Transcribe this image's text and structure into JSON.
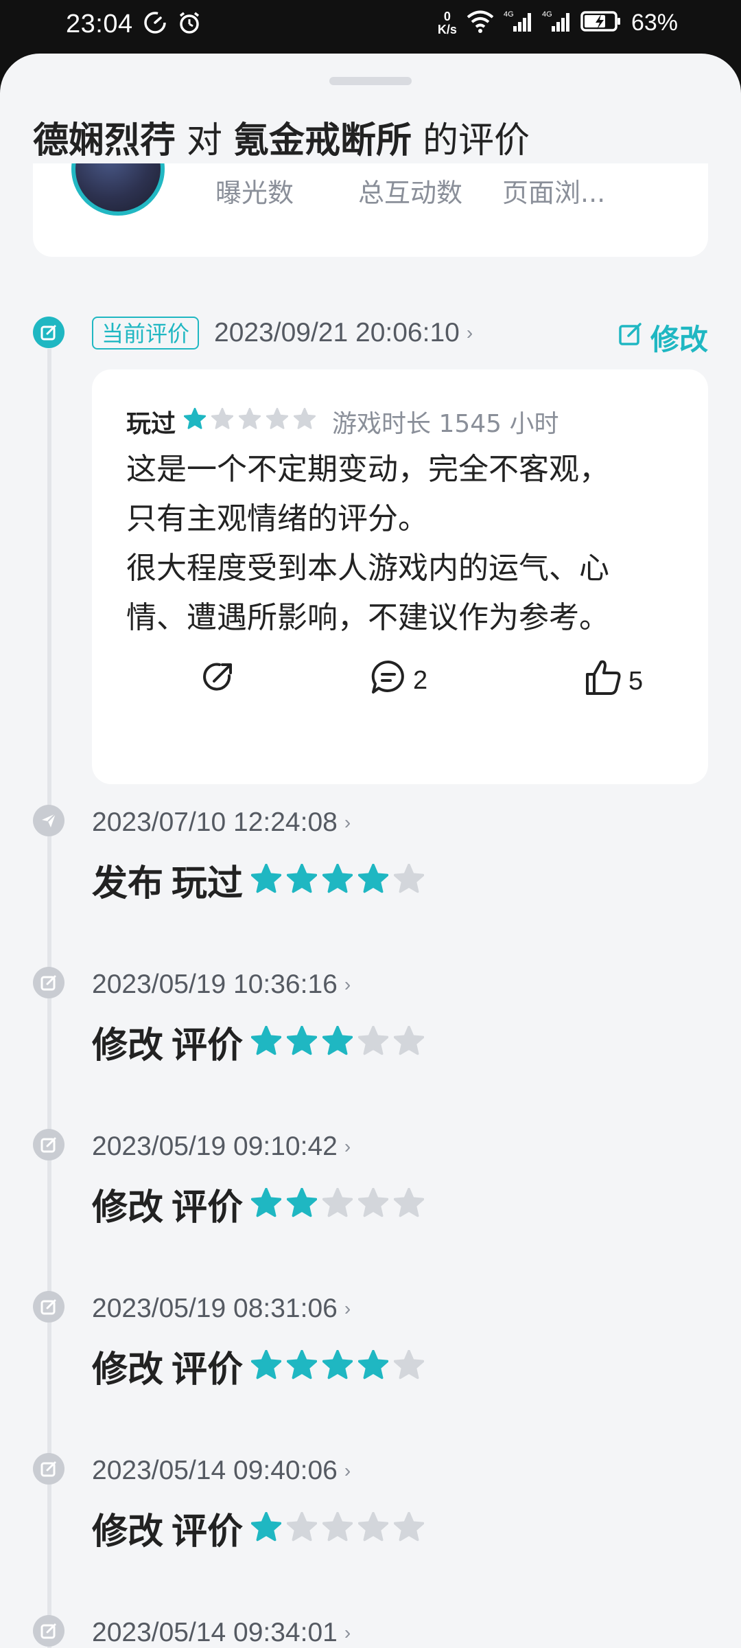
{
  "status_bar": {
    "time": "23:04",
    "net_speed_top": "0",
    "net_speed_bottom": "K/s",
    "battery_text": "63%"
  },
  "header": {
    "user": "德娴烈荇",
    "joiner": "对",
    "game": "氪金戒断所",
    "suffix": "的评价"
  },
  "stats": {
    "labels": [
      "曝光数",
      "总互动数",
      "页面浏..."
    ]
  },
  "current_review": {
    "tag": "当前评价",
    "datetime": "2023/09/21 20:06:10",
    "edit_label": "修改",
    "played_label": "玩过",
    "rating": 1,
    "playtime": "游戏时长 1545 小时",
    "body_lines": [
      "这是一个不定期变动，完全不客观，",
      "只有主观情绪的评分。",
      "很大程度受到本人游戏内的运气、心",
      "情、遭遇所影响，不建议作为参考。"
    ],
    "comment_count": "2",
    "like_count": "5"
  },
  "history": [
    {
      "datetime": "2023/07/10 12:24:08",
      "action": "发布",
      "type": "玩过",
      "rating": 4,
      "icon": "send-icon"
    },
    {
      "datetime": "2023/05/19 10:36:16",
      "action": "修改",
      "type": "评价",
      "rating": 3,
      "icon": "edit-icon"
    },
    {
      "datetime": "2023/05/19 09:10:42",
      "action": "修改",
      "type": "评价",
      "rating": 2,
      "icon": "edit-icon"
    },
    {
      "datetime": "2023/05/19 08:31:06",
      "action": "修改",
      "type": "评价",
      "rating": 4,
      "icon": "edit-icon"
    },
    {
      "datetime": "2023/05/14 09:40:06",
      "action": "修改",
      "type": "评价",
      "rating": 1,
      "icon": "edit-icon"
    },
    {
      "datetime": "2023/05/14 09:34:01",
      "action": "",
      "type": "",
      "rating": 0,
      "icon": "edit-icon"
    }
  ],
  "colors": {
    "accent": "#1fb7c2",
    "star_off": "#d3d6db",
    "bg": "#f4f5f7"
  }
}
